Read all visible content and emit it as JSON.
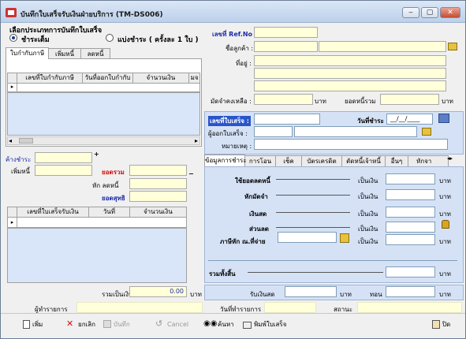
{
  "window": {
    "title": "บันทึกใบเสร็จรับเงินฝ่ายบริการ (TM-DS006)",
    "min": "‒",
    "max": "▢",
    "close": "✕"
  },
  "record_type": {
    "label": "เลือกประเภทการบันทึกใบเสร็จ",
    "opt1": "ชำระเต็ม",
    "opt2": "แบ่งชำระ ( ครั้งละ 1 ใบ )"
  },
  "left_tabs": [
    "ใบกำกับภาษี",
    "เพิ่มหนี้",
    "ลดหนี้"
  ],
  "invoice_grid": {
    "headers": [
      "เลขที่ใบกำกับภาษี",
      "วันที่ออกใบกำกับ",
      "จำนวนเงิน",
      "มจ"
    ]
  },
  "mid_left": {
    "discount_label": "ค้างชำระ",
    "adddebt_label": "เพิ่มหนี้",
    "plus": "+",
    "total_label": "ยอดรวม",
    "reduce_label": "หัก ลดหนี้",
    "minus": "−",
    "net_label": "ยอดสุทธิ"
  },
  "receipt_grid": {
    "headers": [
      "เลขที่ใบเสร็จรับเงิน",
      "วันที่",
      "จำนวนเงิน"
    ]
  },
  "customer": {
    "ref_label": "เลขที่ Ref.No :",
    "name_label": "ชื่อลูกค้า :",
    "addr_label": "ที่อยู่ :",
    "deposit_label": "มัดจำคงเหลือ :",
    "baht": "บาท",
    "debt_label": "ยอดหนี้รวม"
  },
  "receipt": {
    "no_label": "เลขที่ใบเสร็จ :",
    "date_label": "วันที่ชำระ",
    "date_value": "__/__/____",
    "issuer_label": "ผู้ออกใบเสร็จ :",
    "note_label": "หมายเหตุ :"
  },
  "pay_tabs": [
    "ข้อมูลการชำระ",
    "การโอน",
    "เช็ค",
    "บัตรเครดิต",
    "ตัดหนี้เจ้าหนี้",
    "อื่นๆ",
    "หักจา"
  ],
  "pay_rows": [
    {
      "label": "ใช้ยอดลดหนี้",
      "amount_label": "เป็นเงิน",
      "unit": "บาท"
    },
    {
      "label": "หักมัดจำ",
      "amount_label": "เป็นเงิน",
      "unit": "บาท"
    },
    {
      "label": "เงินสด",
      "amount_label": "เป็นเงิน",
      "unit": "บาท"
    },
    {
      "label": "ส่วนลด",
      "amount_label": "เป็นเงิน",
      "unit": "บาท"
    },
    {
      "label": "ภาษีหัก ณ.ที่จ่าย",
      "amount_label": "เป็นเงิน",
      "unit": "บาท"
    }
  ],
  "pay_total": {
    "label": "รวมทั้งสิ้น",
    "unit": "บาท"
  },
  "bottom": {
    "sum_label": "รวมเป็นเงิน",
    "sum_value": "0.00",
    "baht": "บาท",
    "cash_label": "รับเงินสด",
    "change_label": "ทอน"
  },
  "status": {
    "user_label": "ผู้ทำรายการ",
    "date_label": "วันที่ทำรายการ",
    "state_label": "สถานะ"
  },
  "toolbar": {
    "add": "เพิ่ม",
    "cancel_rec": "ยกเลิก",
    "save": "บันทึก",
    "cancel": "Cancel",
    "search": "ค้นหา",
    "print": "พิมพ์ใบเสร็จ",
    "exit": "ปิด"
  },
  "colors": {
    "title_blue": "#1b2ba8",
    "red": "#d01010",
    "field_yellow": "#ffffd9",
    "panel_blue": "#d5e2f6"
  }
}
